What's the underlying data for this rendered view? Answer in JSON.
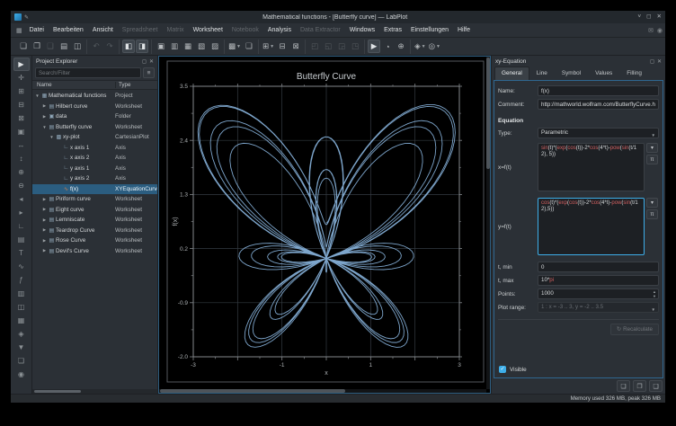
{
  "window": {
    "title": "Mathematical functions - [Butterfly curve] — LabPlot",
    "controls": [
      {
        "name": "minimize",
        "glyph": "˅"
      },
      {
        "name": "maximize",
        "glyph": "◻"
      },
      {
        "name": "close",
        "glyph": "✕"
      }
    ],
    "pin_glyph": "✎"
  },
  "menubar": {
    "menu_glyph": "▦",
    "items": [
      {
        "label": "Datei",
        "enabled": true
      },
      {
        "label": "Bearbeiten",
        "enabled": true
      },
      {
        "label": "Ansicht",
        "enabled": true
      },
      {
        "label": "Spreadsheet",
        "enabled": false
      },
      {
        "label": "Matrix",
        "enabled": false
      },
      {
        "label": "Worksheet",
        "enabled": true
      },
      {
        "label": "Notebook",
        "enabled": false
      },
      {
        "label": "Analysis",
        "enabled": true
      },
      {
        "label": "Data Extractor",
        "enabled": false
      },
      {
        "label": "Windows",
        "enabled": true
      },
      {
        "label": "Extras",
        "enabled": true
      },
      {
        "label": "Einstellungen",
        "enabled": true
      },
      {
        "label": "Hilfe",
        "enabled": true
      }
    ],
    "right_icons": [
      {
        "name": "notification-icon",
        "glyph": "✉"
      },
      {
        "name": "session-icon",
        "glyph": "◉"
      }
    ]
  },
  "toolbar": {
    "groups": [
      {
        "items": [
          {
            "name": "new-project-button",
            "glyph": "❏"
          },
          {
            "name": "open-project-button",
            "glyph": "❐"
          },
          {
            "name": "save-project-button",
            "glyph": "❑",
            "disabled": true
          },
          {
            "name": "print-button",
            "glyph": "▤"
          },
          {
            "name": "export-button",
            "glyph": "◫"
          }
        ]
      },
      {
        "items": [
          {
            "name": "undo-button",
            "glyph": "↶",
            "disabled": true
          },
          {
            "name": "redo-button",
            "glyph": "↷",
            "disabled": true
          }
        ]
      },
      {
        "items": [
          {
            "name": "toggle-project-explorer-button",
            "glyph": "◧",
            "active": true
          },
          {
            "name": "toggle-properties-dock-button",
            "glyph": "◨",
            "active": true
          }
        ]
      },
      {
        "items": [
          {
            "name": "new-folder-button",
            "glyph": "▣"
          },
          {
            "name": "new-workbook-button",
            "glyph": "▥"
          },
          {
            "name": "new-spreadsheet-button",
            "glyph": "▦"
          },
          {
            "name": "new-matrix-button",
            "glyph": "▧"
          },
          {
            "name": "new-worksheet-button",
            "glyph": "▨"
          }
        ]
      },
      {
        "items": [
          {
            "name": "new-plot-button",
            "glyph": "▩",
            "dropdown": true
          },
          {
            "name": "duplicate-button",
            "glyph": "❏"
          }
        ]
      },
      {
        "items": [
          {
            "name": "zoom-mode-button",
            "glyph": "⊞",
            "dropdown": true
          },
          {
            "name": "zoom-fit-button",
            "glyph": "⊟"
          },
          {
            "name": "zoom-region-button",
            "glyph": "⊠"
          }
        ]
      },
      {
        "items": [
          {
            "name": "add-curve-button",
            "glyph": "◰",
            "disabled": true
          },
          {
            "name": "add-equation-button",
            "glyph": "◱",
            "disabled": true
          },
          {
            "name": "add-fit-button",
            "glyph": "◲",
            "disabled": true
          },
          {
            "name": "add-analysis-button",
            "glyph": "◳",
            "disabled": true
          }
        ]
      },
      {
        "items": [
          {
            "name": "select-mode-button",
            "glyph": "▶",
            "active": true
          },
          {
            "name": "crosshair-mode-button",
            "glyph": "◔"
          },
          {
            "name": "zoom-select-mode-button",
            "glyph": "⊕"
          }
        ]
      },
      {
        "items": [
          {
            "name": "plot-style-button",
            "glyph": "◈",
            "dropdown": true
          },
          {
            "name": "layout-button",
            "glyph": "◎",
            "dropdown": true
          }
        ]
      }
    ]
  },
  "left_toolbar": {
    "icons": [
      {
        "name": "select-mode-icon",
        "glyph": "▶",
        "active": true
      },
      {
        "name": "pan-mode-icon",
        "glyph": "✛"
      },
      {
        "name": "zoom-select-icon",
        "glyph": "⊞"
      },
      {
        "name": "zoom-x-select-icon",
        "glyph": "⊟"
      },
      {
        "name": "zoom-y-select-icon",
        "glyph": "⊠"
      },
      {
        "name": "auto-scale-icon",
        "glyph": "▣"
      },
      {
        "name": "auto-scale-x-icon",
        "glyph": "↔"
      },
      {
        "name": "auto-scale-y-icon",
        "glyph": "↕"
      },
      {
        "name": "zoom-in-icon",
        "glyph": "⊕"
      },
      {
        "name": "zoom-out-icon",
        "glyph": "⊖"
      },
      {
        "name": "shift-left-x-icon",
        "glyph": "◂"
      },
      {
        "name": "shift-right-x-icon",
        "glyph": "▸"
      },
      {
        "name": "add-axis-icon",
        "glyph": "∟"
      },
      {
        "name": "add-legend-icon",
        "glyph": "▤"
      },
      {
        "name": "add-text-icon",
        "glyph": "T"
      },
      {
        "name": "add-curve-icon",
        "glyph": "∿"
      },
      {
        "name": "add-equation-icon",
        "glyph": "ƒ"
      },
      {
        "name": "add-histogram-icon",
        "glyph": "▥"
      },
      {
        "name": "add-boxplot-icon",
        "glyph": "◫"
      },
      {
        "name": "add-image-icon",
        "glyph": "▦"
      },
      {
        "name": "add-info-element-icon",
        "glyph": "◈"
      },
      {
        "name": "export-worksheet-icon",
        "glyph": "▼"
      },
      {
        "name": "print-worksheet-icon",
        "glyph": "❏"
      },
      {
        "name": "presenter-mode-icon",
        "glyph": "◉"
      }
    ]
  },
  "project_explorer": {
    "title": "Project Explorer",
    "header_icons": [
      {
        "name": "float-dock-icon",
        "glyph": "◻"
      },
      {
        "name": "close-dock-icon",
        "glyph": "✕"
      }
    ],
    "search_placeholder": "Search/Filter",
    "filter_button_glyph": "≡",
    "columns": [
      "Name",
      "Type"
    ],
    "rows": [
      {
        "name": "Mathematical functions",
        "type": "Project",
        "indent": 0,
        "expander": "open",
        "icon": "project-icon",
        "glyph": "▦"
      },
      {
        "name": "Hilbert curve",
        "type": "Worksheet",
        "indent": 1,
        "expander": "closed",
        "icon": "worksheet-icon",
        "glyph": "▤"
      },
      {
        "name": "data",
        "type": "Folder",
        "indent": 1,
        "expander": "closed",
        "icon": "folder-icon",
        "glyph": "▣"
      },
      {
        "name": "Butterfly curve",
        "type": "Worksheet",
        "indent": 1,
        "expander": "open",
        "icon": "worksheet-icon",
        "glyph": "▤"
      },
      {
        "name": "xy-plot",
        "type": "CartesianPlot",
        "indent": 2,
        "expander": "open",
        "icon": "plot-icon",
        "glyph": "▩"
      },
      {
        "name": "x axis 1",
        "type": "Axis",
        "indent": 3,
        "expander": "none",
        "icon": "axis-icon",
        "glyph": "∟"
      },
      {
        "name": "x axis 2",
        "type": "Axis",
        "indent": 3,
        "expander": "none",
        "icon": "axis-icon",
        "glyph": "∟"
      },
      {
        "name": "y axis 1",
        "type": "Axis",
        "indent": 3,
        "expander": "none",
        "icon": "axis-icon",
        "glyph": "∟"
      },
      {
        "name": "y axis 2",
        "type": "Axis",
        "indent": 3,
        "expander": "none",
        "icon": "axis-icon",
        "glyph": "∟"
      },
      {
        "name": "f(x)",
        "type": "XYEquationCurve",
        "indent": 3,
        "expander": "none",
        "icon": "equation-curve-icon",
        "glyph": "∿",
        "selected": true
      },
      {
        "name": "Piriform curve",
        "type": "Worksheet",
        "indent": 1,
        "expander": "closed",
        "icon": "worksheet-icon",
        "glyph": "▤"
      },
      {
        "name": "Eight curve",
        "type": "Worksheet",
        "indent": 1,
        "expander": "closed",
        "icon": "worksheet-icon",
        "glyph": "▤"
      },
      {
        "name": "Lemniscate",
        "type": "Worksheet",
        "indent": 1,
        "expander": "closed",
        "icon": "worksheet-icon",
        "glyph": "▤"
      },
      {
        "name": "Teardrop Curve",
        "type": "Worksheet",
        "indent": 1,
        "expander": "closed",
        "icon": "worksheet-icon",
        "glyph": "▤"
      },
      {
        "name": "Rose Curve",
        "type": "Worksheet",
        "indent": 1,
        "expander": "closed",
        "icon": "worksheet-icon",
        "glyph": "▤"
      },
      {
        "name": "Devil's Curve",
        "type": "Worksheet",
        "indent": 1,
        "expander": "closed",
        "icon": "worksheet-icon",
        "glyph": "▤"
      }
    ]
  },
  "plot": {
    "title": "Butterfly Curve",
    "xlabel": "x",
    "ylabel": "f(x)",
    "xlim": [
      -3,
      3
    ],
    "ylim": [
      -2,
      3.5
    ],
    "x_major_ticks": [
      -3,
      -2,
      -1,
      0,
      1,
      2,
      3
    ],
    "x_tick_labels": [
      {
        "value": -3,
        "label": "-3"
      },
      {
        "value": -1,
        "label": "-1"
      },
      {
        "value": 1,
        "label": "1"
      },
      {
        "value": 3,
        "label": "3"
      }
    ],
    "y_major_ticks": [
      3.5,
      2.4,
      1.3,
      0.2,
      -0.9,
      -2
    ],
    "y_tick_labels": [
      {
        "value": 3.5,
        "label": "3.5"
      },
      {
        "value": 2.4,
        "label": "2.4"
      },
      {
        "value": 1.3,
        "label": "1.3"
      },
      {
        "value": 0.2,
        "label": "0.2"
      },
      {
        "value": -0.9,
        "label": "-0.9"
      },
      {
        "value": -2,
        "label": "-2.0"
      }
    ],
    "curve_color": "#84aed6",
    "t_min": 0,
    "t_max": 31.41592653589793,
    "points": 1000
  },
  "properties": {
    "dock_title": "xy-Equation",
    "header_icons": [
      {
        "name": "float-dock-icon",
        "glyph": "◻"
      },
      {
        "name": "close-dock-icon",
        "glyph": "✕"
      }
    ],
    "tabs": [
      {
        "label": "General",
        "active": true
      },
      {
        "label": "Line",
        "active": false
      },
      {
        "label": "Symbol",
        "active": false
      },
      {
        "label": "Values",
        "active": false
      },
      {
        "label": "Filling",
        "active": false
      }
    ],
    "name_label": "Name:",
    "name_value": "f(x)",
    "comment_label": "Comment:",
    "comment_value": "http://mathworld.wolfram.com/ButterflyCurve.html",
    "equation_heading": "Equation",
    "type_label": "Type:",
    "type_value": "Parametric",
    "x_label": "x=f(t)",
    "x_formula": "sin(t)*(exp(cos(t))-2*cos(4*t)-pow(sin(t/12), 5))",
    "y_label": "y=f(t)",
    "y_formula": "cos(t)*(exp(cos(t))-2*cos(4*t)-pow(sin(t/12),5))",
    "insert_function_glyph": "▾",
    "insert_constant_glyph": "π",
    "t_min_label": "t, min",
    "t_min_value": "0",
    "t_max_label": "t, max",
    "t_max_value": "10*pi",
    "points_label": "Points:",
    "points_value": "1000",
    "plot_range_label": "Plot range:",
    "plot_range_value": "1 : x = -3 .. 3, y = -2 .. 3.5",
    "recalculate_label": "Recalculate",
    "recalculate_glyph": "↻",
    "visible_label": "Visible",
    "visible_checked": true,
    "bottom_buttons": [
      {
        "name": "copy-settings-button",
        "glyph": "❏"
      },
      {
        "name": "save-default-button",
        "glyph": "❐"
      },
      {
        "name": "load-settings-button",
        "glyph": "❑"
      }
    ]
  },
  "statusbar": {
    "memory": "Memory used 326 MB, peak 326 MB"
  },
  "colors": {
    "accent": "#3daee9",
    "selection": "#2b5d80",
    "function_highlight": "#d35f5f",
    "curve": "#84aed6"
  }
}
